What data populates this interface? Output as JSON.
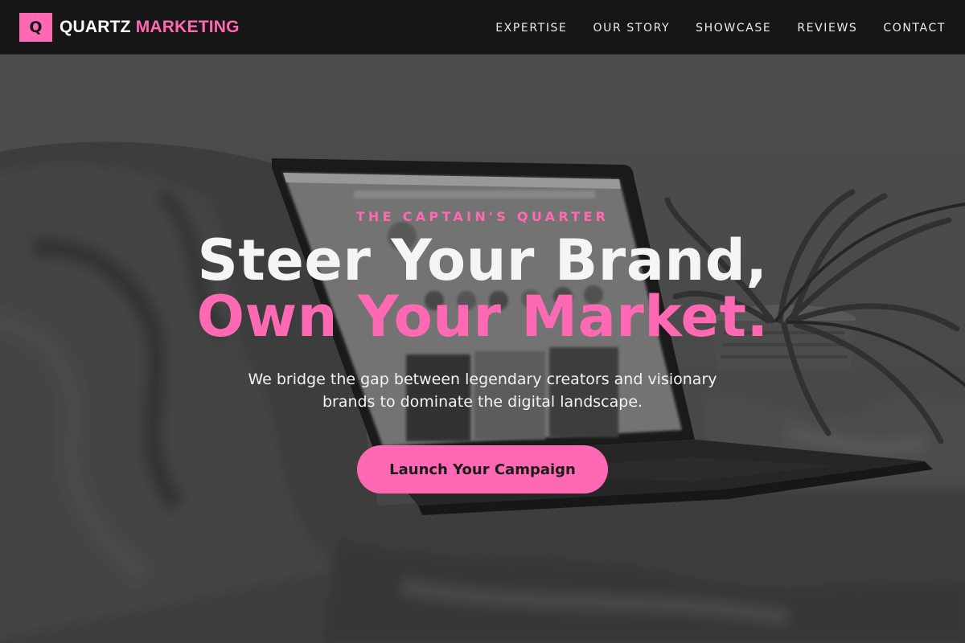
{
  "brand": {
    "mark": "Q",
    "name_primary": "QUARTZ",
    "name_accent": "MARKETING"
  },
  "nav": {
    "items": [
      {
        "label": "EXPERTISE"
      },
      {
        "label": "OUR STORY"
      },
      {
        "label": "SHOWCASE"
      },
      {
        "label": "REVIEWS"
      },
      {
        "label": "CONTACT"
      }
    ]
  },
  "hero": {
    "eyebrow": "THE CAPTAIN'S QUARTER",
    "headline_line1": "Steer Your Brand,",
    "headline_line2": "Own Your Market.",
    "subtext": "We bridge the gap between legendary creators and visionary brands to dominate the digital landscape.",
    "cta_label": "Launch Your Campaign",
    "background_image": "grayscale-laptop-on-blanket-with-plant"
  },
  "colors": {
    "accent": "#ff69b4",
    "nav_background": "#161616",
    "text_light": "#f5f5f7"
  }
}
